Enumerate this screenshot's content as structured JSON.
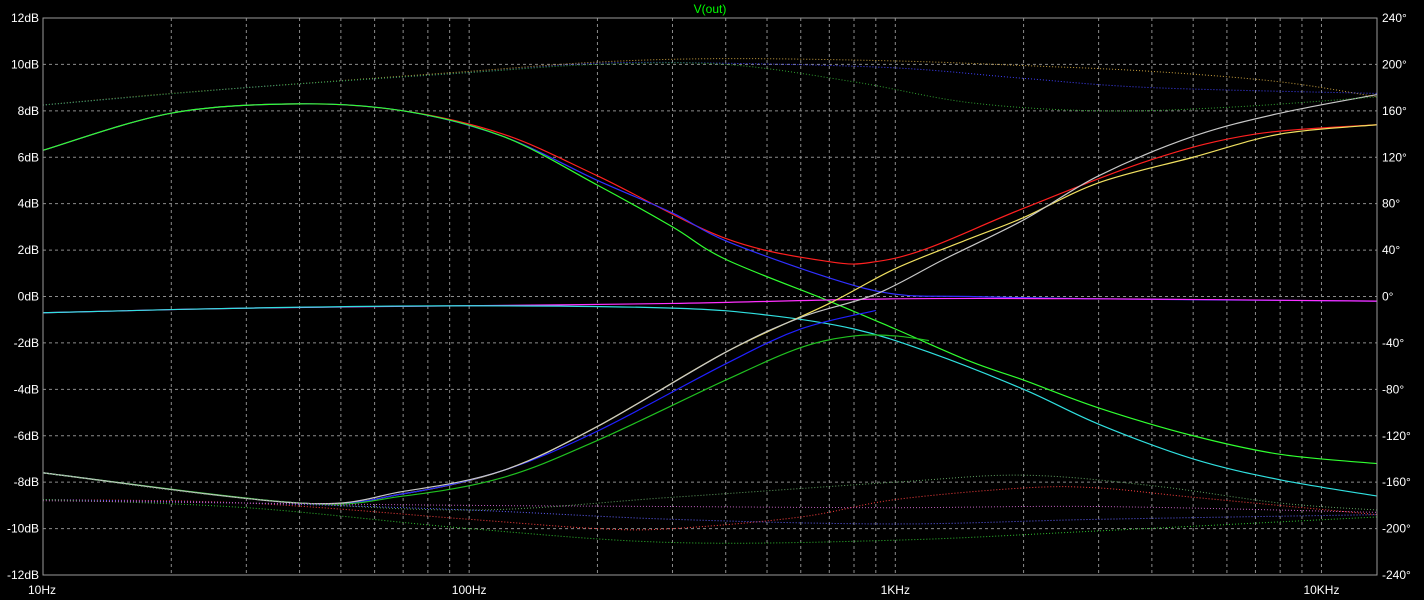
{
  "chart_data": {
    "type": "line",
    "title": "V(out)",
    "xscale": "log",
    "xlim": [
      10,
      13500
    ],
    "y_left": {
      "unit": "dB",
      "lim": [
        -12,
        12
      ]
    },
    "y_right": {
      "unit": "°",
      "lim": [
        -240,
        240
      ]
    },
    "x_ticks": [
      {
        "value": 10,
        "label": "10Hz"
      },
      {
        "value": 100,
        "label": "100Hz"
      },
      {
        "value": 1000,
        "label": "1KHz"
      },
      {
        "value": 10000,
        "label": "10KHz"
      }
    ],
    "y_left_ticks": [
      {
        "value": 12,
        "label": "12dB"
      },
      {
        "value": 10,
        "label": "10dB"
      },
      {
        "value": 8,
        "label": "8dB"
      },
      {
        "value": 6,
        "label": "6dB"
      },
      {
        "value": 4,
        "label": "4dB"
      },
      {
        "value": 2,
        "label": "2dB"
      },
      {
        "value": 0,
        "label": "0dB"
      },
      {
        "value": -2,
        "label": "-2dB"
      },
      {
        "value": -4,
        "label": "-4dB"
      },
      {
        "value": -6,
        "label": "-6dB"
      },
      {
        "value": -8,
        "label": "-8dB"
      },
      {
        "value": -10,
        "label": "-10dB"
      },
      {
        "value": -12,
        "label": "-12dB"
      }
    ],
    "y_right_ticks": [
      {
        "value": 240,
        "label": "240°"
      },
      {
        "value": 200,
        "label": "200°"
      },
      {
        "value": 160,
        "label": "160°"
      },
      {
        "value": 120,
        "label": "120°"
      },
      {
        "value": 80,
        "label": "80°"
      },
      {
        "value": 40,
        "label": "40°"
      },
      {
        "value": 0,
        "label": "0°"
      },
      {
        "value": -40,
        "label": "-40°"
      },
      {
        "value": -80,
        "label": "-80°"
      },
      {
        "value": -120,
        "label": "-120°"
      },
      {
        "value": -160,
        "label": "-160°"
      },
      {
        "value": -200,
        "label": "-200°"
      },
      {
        "value": -240,
        "label": "-240°"
      }
    ],
    "grid": true,
    "colors": {
      "background": "#000000",
      "grid": "#8c8c8c",
      "axis": "#9a9a9a",
      "label": "#ffffff",
      "title": "#00ff00"
    },
    "series": [
      {
        "kind": "magnitude",
        "color": "#ff2020",
        "x": [
          10,
          20,
          40,
          70,
          120,
          200,
          400,
          700,
          900,
          1200,
          2000,
          4000,
          7000,
          13500
        ],
        "y": [
          6.3,
          7.9,
          8.3,
          8.0,
          7.0,
          5.2,
          2.5,
          1.5,
          1.5,
          2.1,
          3.8,
          5.9,
          7.0,
          7.4
        ]
      },
      {
        "kind": "magnitude",
        "color": "#3030ff",
        "x": [
          10,
          20,
          40,
          70,
          120,
          200,
          300,
          400,
          700,
          1000,
          1500,
          3000,
          13500
        ],
        "y": [
          6.3,
          7.9,
          8.3,
          8.0,
          6.9,
          5.0,
          3.6,
          2.4,
          0.8,
          0.1,
          0.0,
          -0.1,
          -0.2
        ]
      },
      {
        "kind": "magnitude",
        "color": "#30ff30",
        "x": [
          10,
          20,
          40,
          70,
          120,
          200,
          300,
          400,
          700,
          1000,
          1500,
          2000,
          3000,
          5000,
          8000,
          13500
        ],
        "y": [
          6.3,
          7.9,
          8.3,
          8.0,
          6.9,
          4.8,
          3.0,
          1.6,
          -0.2,
          -1.4,
          -2.8,
          -3.6,
          -4.8,
          -6.0,
          -6.8,
          -7.2
        ]
      },
      {
        "kind": "magnitude",
        "color": "#ff30ff",
        "x": [
          10,
          30,
          100,
          300,
          1000,
          3000,
          13500
        ],
        "y": [
          -0.7,
          -0.5,
          -0.4,
          -0.3,
          -0.1,
          -0.1,
          -0.2
        ]
      },
      {
        "kind": "magnitude",
        "color": "#30e0e0",
        "x": [
          10,
          30,
          100,
          300,
          500,
          800,
          1200,
          2000,
          3000,
          5000,
          8000,
          13500
        ],
        "y": [
          -0.7,
          -0.5,
          -0.4,
          -0.5,
          -0.8,
          -1.4,
          -2.4,
          -4.0,
          -5.5,
          -7.0,
          -7.9,
          -8.6
        ]
      },
      {
        "kind": "magnitude",
        "color": "#f0e060",
        "x": [
          10,
          40,
          70,
          120,
          200,
          400,
          700,
          1000,
          1500,
          2000,
          3000,
          5000,
          8000,
          13500
        ],
        "y": [
          -7.6,
          -8.9,
          -8.5,
          -7.5,
          -5.6,
          -2.4,
          -0.3,
          1.2,
          2.5,
          3.4,
          4.9,
          6.0,
          7.0,
          7.4
        ]
      },
      {
        "kind": "magnitude",
        "color": "#2020ff",
        "x": [
          10,
          40,
          70,
          120,
          200,
          400,
          600,
          900
        ],
        "y": [
          -7.6,
          -8.9,
          -8.5,
          -7.5,
          -5.8,
          -2.9,
          -1.4,
          -0.6
        ]
      },
      {
        "kind": "magnitude",
        "color": "#20c020",
        "x": [
          10,
          40,
          70,
          120,
          200,
          400,
          600,
          800,
          1000,
          1200
        ],
        "y": [
          -7.6,
          -8.9,
          -8.6,
          -7.8,
          -6.2,
          -3.6,
          -2.2,
          -1.7,
          -1.7,
          -1.9
        ]
      },
      {
        "kind": "magnitude",
        "color": "#c8c8c8",
        "x": [
          10,
          40,
          70,
          120,
          200,
          400,
          600,
          900,
          1300,
          2000,
          3000,
          5000,
          8000,
          13500
        ],
        "y": [
          -7.6,
          -8.9,
          -8.4,
          -7.5,
          -5.6,
          -2.4,
          -0.9,
          0.1,
          1.6,
          3.3,
          5.2,
          6.9,
          7.9,
          8.7
        ]
      },
      {
        "kind": "phase",
        "color": "#c8a040",
        "x": [
          10,
          20,
          50,
          100,
          200,
          400,
          1000,
          2000,
          4000,
          8000,
          13500
        ],
        "y": [
          165,
          175,
          186,
          194,
          202,
          205,
          203,
          199,
          194,
          185,
          172
        ]
      },
      {
        "kind": "phase",
        "color": "#4040ff",
        "x": [
          10,
          30,
          100,
          200,
          400,
          1000,
          2000,
          4000,
          13500
        ],
        "y": [
          165,
          180,
          193,
          201,
          201,
          197,
          188,
          180,
          175
        ]
      },
      {
        "kind": "phase",
        "color": "#30a030",
        "x": [
          10,
          30,
          100,
          200,
          400,
          800,
          1500,
          3000,
          6000,
          13500
        ],
        "y": [
          165,
          180,
          193,
          200,
          200,
          185,
          167,
          160,
          163,
          172
        ]
      },
      {
        "kind": "phase",
        "color": "#ff4040",
        "x": [
          10,
          30,
          100,
          200,
          300,
          600,
          1000,
          2000,
          3000,
          5000,
          13500
        ],
        "y": [
          -175,
          -178,
          -192,
          -200,
          -200,
          -190,
          -175,
          -165,
          -165,
          -173,
          -188
        ]
      },
      {
        "kind": "phase",
        "color": "#6060ff",
        "x": [
          10,
          30,
          100,
          300,
          1000,
          3000,
          13500
        ],
        "y": [
          -175,
          -178,
          -184,
          -192,
          -196,
          -192,
          -188
        ]
      },
      {
        "kind": "phase",
        "color": "#30c030",
        "x": [
          10,
          30,
          100,
          300,
          1000,
          3000,
          13500
        ],
        "y": [
          -175,
          -182,
          -200,
          -212,
          -210,
          -202,
          -190
        ]
      },
      {
        "kind": "phase",
        "color": "#c060c0",
        "x": [
          10,
          30,
          100,
          300,
          1000,
          3000,
          13500
        ],
        "y": [
          -176,
          -178,
          -180,
          -181,
          -182,
          -181,
          -186
        ]
      },
      {
        "kind": "phase",
        "color": "#60a060",
        "x": [
          10,
          30,
          100,
          300,
          1000,
          2000,
          4000,
          8000,
          13500
        ],
        "y": [
          -152,
          -174,
          -184,
          -173,
          -160,
          -154,
          -163,
          -178,
          -184
        ]
      }
    ]
  }
}
